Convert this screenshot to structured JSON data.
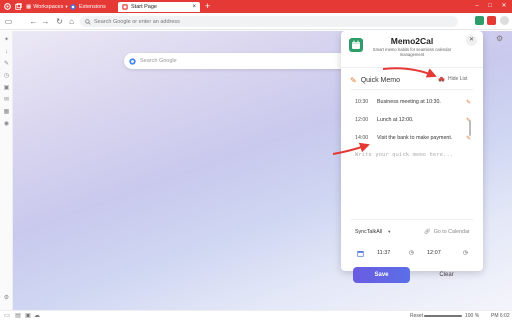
{
  "browser": {
    "workspaces_label": "Workspaces",
    "tabs": [
      {
        "label": "Extensions",
        "active": false
      },
      {
        "label": "Start Page",
        "active": true
      }
    ],
    "new_tab_glyph": "+",
    "window_controls": [
      "–",
      "□",
      "✕"
    ],
    "address_placeholder": "Search Google or enter an address",
    "accent": "#e53935"
  },
  "start_page": {
    "search_placeholder": "Search Google"
  },
  "popup": {
    "title": "Memo2Cal",
    "subtitle": "Smart memo habits for seamless calendar management",
    "close_glyph": "✕",
    "quick_memo_label": "Quick Memo",
    "hide_list_label": "Hide List",
    "memos": [
      {
        "time": "10:30",
        "text": "Business meeting at 10:30."
      },
      {
        "time": "12:00",
        "text": "Lunch at 12:00."
      },
      {
        "time": "14:00",
        "text": "Visit the bank to make payment."
      }
    ],
    "memo_input_placeholder": "Write your quick memo here...",
    "sync_option": "SyncTalkAll",
    "goto_calendar_label": "Go to Calendar",
    "start_time": "11:37",
    "end_time": "12:07",
    "save_label": "Save",
    "clear_label": "Clear",
    "icon_color": "#2e9d6a",
    "edit_color": "#e07b2d",
    "save_color": "#6a5ce0"
  },
  "statusbar": {
    "reset_label": "Reset",
    "zoom_label": "100 %",
    "zoom_fraction": 1.0,
    "clock": "PM 6:02"
  },
  "annotations": {
    "arrow_color": "#e53935"
  }
}
